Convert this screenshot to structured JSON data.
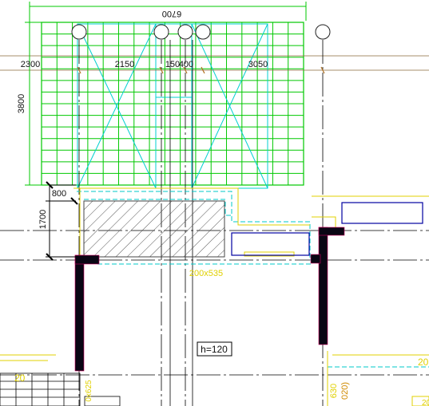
{
  "colors": {
    "grid": "#00c800",
    "truss": "#00d0d0",
    "wall": "#0a0614",
    "dashed": "#00c8c8",
    "axis": "#000000",
    "hatch": "#333333",
    "yellow": "#e0d000",
    "blue": "#0000a0"
  },
  "dims": {
    "top_width": "6700",
    "left_offset": "2300",
    "span_a": "2150",
    "span_b": "150",
    "span_c": "400",
    "span_d": "3050",
    "grid_height": "3800",
    "gap": "800",
    "slab_depth": "1700"
  },
  "labels": {
    "slab_size": "200x535",
    "height_tag": "h=120",
    "right_tag": "20",
    "right_note": "020)",
    "right_note_b": "630",
    "bottom_tag": "20",
    "bottom_left_tag": "20",
    "bottom_left_note": "0x625"
  }
}
